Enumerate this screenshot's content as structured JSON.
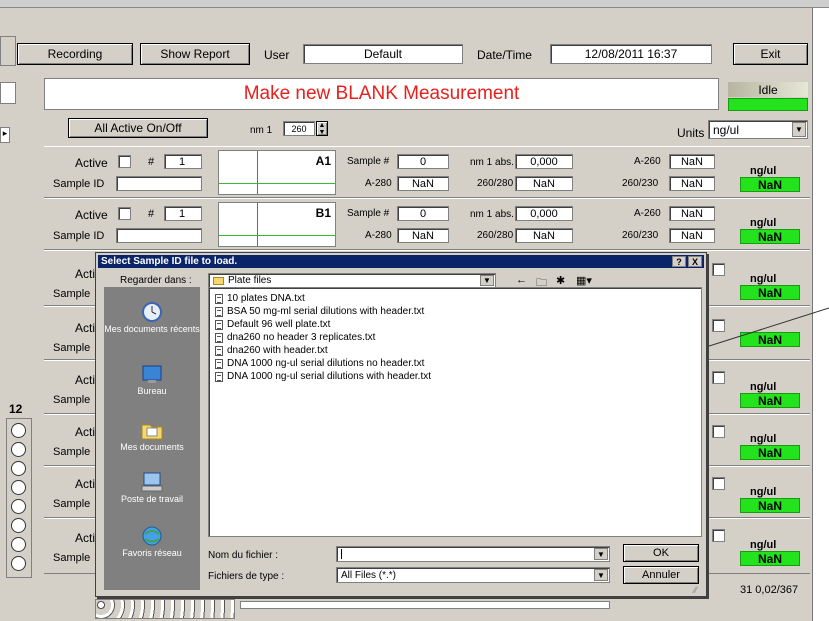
{
  "toolbar": {
    "recording": "Recording",
    "show_report": "Show Report",
    "user_label": "User",
    "user_value": "Default",
    "datetime_label": "Date/Time",
    "datetime_value": "12/08/2011  16:37",
    "exit": "Exit"
  },
  "main": {
    "title": "Make new BLANK Measurement",
    "status": "Idle",
    "all_active": "All Active On/Off",
    "nm_label": "nm 1",
    "nm_value": "260",
    "units_label": "Units",
    "units_value": "ng/ul",
    "row_number": "12",
    "footer_fragment": "31 0,02/367"
  },
  "samples": [
    {
      "active_label": "Active",
      "hash_label": "#",
      "number": "1",
      "sample_id_label": "Sample ID",
      "well": "A1",
      "sample_num_label": "Sample #",
      "sample_num": "0",
      "nm1_abs_label": "nm 1 abs.",
      "nm1_abs": "0,000",
      "a260_label": "A-260",
      "a260": "NaN",
      "a280_label": "A-280",
      "a280": "NaN",
      "r260_280_label": "260/280",
      "r260_280": "NaN",
      "r260_230_label": "260/230",
      "r260_230": "NaN",
      "unit": "ng/ul",
      "result": "NaN"
    },
    {
      "active_label": "Active",
      "hash_label": "#",
      "number": "1",
      "sample_id_label": "Sample ID",
      "well": "B1",
      "sample_num_label": "Sample #",
      "sample_num": "0",
      "nm1_abs_label": "nm 1 abs.",
      "nm1_abs": "0,000",
      "a260_label": "A-260",
      "a260": "NaN",
      "a280_label": "A-280",
      "a280": "NaN",
      "r260_280_label": "260/280",
      "r260_280": "NaN",
      "r260_230_label": "260/230",
      "r260_230": "NaN",
      "unit": "ng/ul",
      "result": "NaN"
    }
  ],
  "partial_rows": [
    {
      "active_label": "Acti",
      "sample_label": "Sample",
      "unit": "ng/ul",
      "result": "NaN"
    },
    {
      "active_label": "Acti",
      "sample_label": "Sample",
      "unit": "",
      "result": "NaN"
    },
    {
      "active_label": "Acti",
      "sample_label": "Sample",
      "unit": "ng/ul",
      "result": "NaN"
    },
    {
      "active_label": "Acti",
      "sample_label": "Sample",
      "unit": "ng/ul",
      "result": "NaN"
    },
    {
      "active_label": "Acti",
      "sample_label": "Sample",
      "unit": "ng/ul",
      "result": "NaN"
    },
    {
      "active_label": "Acti",
      "sample_label": "Sample",
      "unit": "ng/ul",
      "result": "NaN"
    }
  ],
  "dialog": {
    "title": "Select Sample ID file to load.",
    "help_btn": "?",
    "close_btn": "X",
    "look_in_label": "Regarder dans :",
    "look_in_value": "Plate files",
    "places": [
      {
        "label": "Mes documents récents",
        "icon": "recent-documents-icon"
      },
      {
        "label": "Bureau",
        "icon": "desktop-icon"
      },
      {
        "label": "Mes documents",
        "icon": "my-documents-icon"
      },
      {
        "label": "Poste de travail",
        "icon": "my-computer-icon"
      },
      {
        "label": "Favoris réseau",
        "icon": "network-places-icon"
      }
    ],
    "files": [
      "10 plates DNA.txt",
      "BSA 50 mg-ml serial dilutions with header.txt",
      "Default 96 well plate.txt",
      "dna260 no header 3 replicates.txt",
      "dna260 with header.txt",
      "DNA 1000 ng-ul serial dilutions no header.txt",
      "DNA 1000 ng-ul serial dilutions with header.txt"
    ],
    "filename_label": "Nom du fichier :",
    "filename_value": "",
    "filetype_label": "Fichiers de type :",
    "filetype_value": "All Files (*.*)",
    "ok": "OK",
    "cancel": "Annuler"
  },
  "colors": {
    "accent_red": "#e8201c",
    "result_green": "#22e31c",
    "dialog_title": "#0a246a"
  }
}
